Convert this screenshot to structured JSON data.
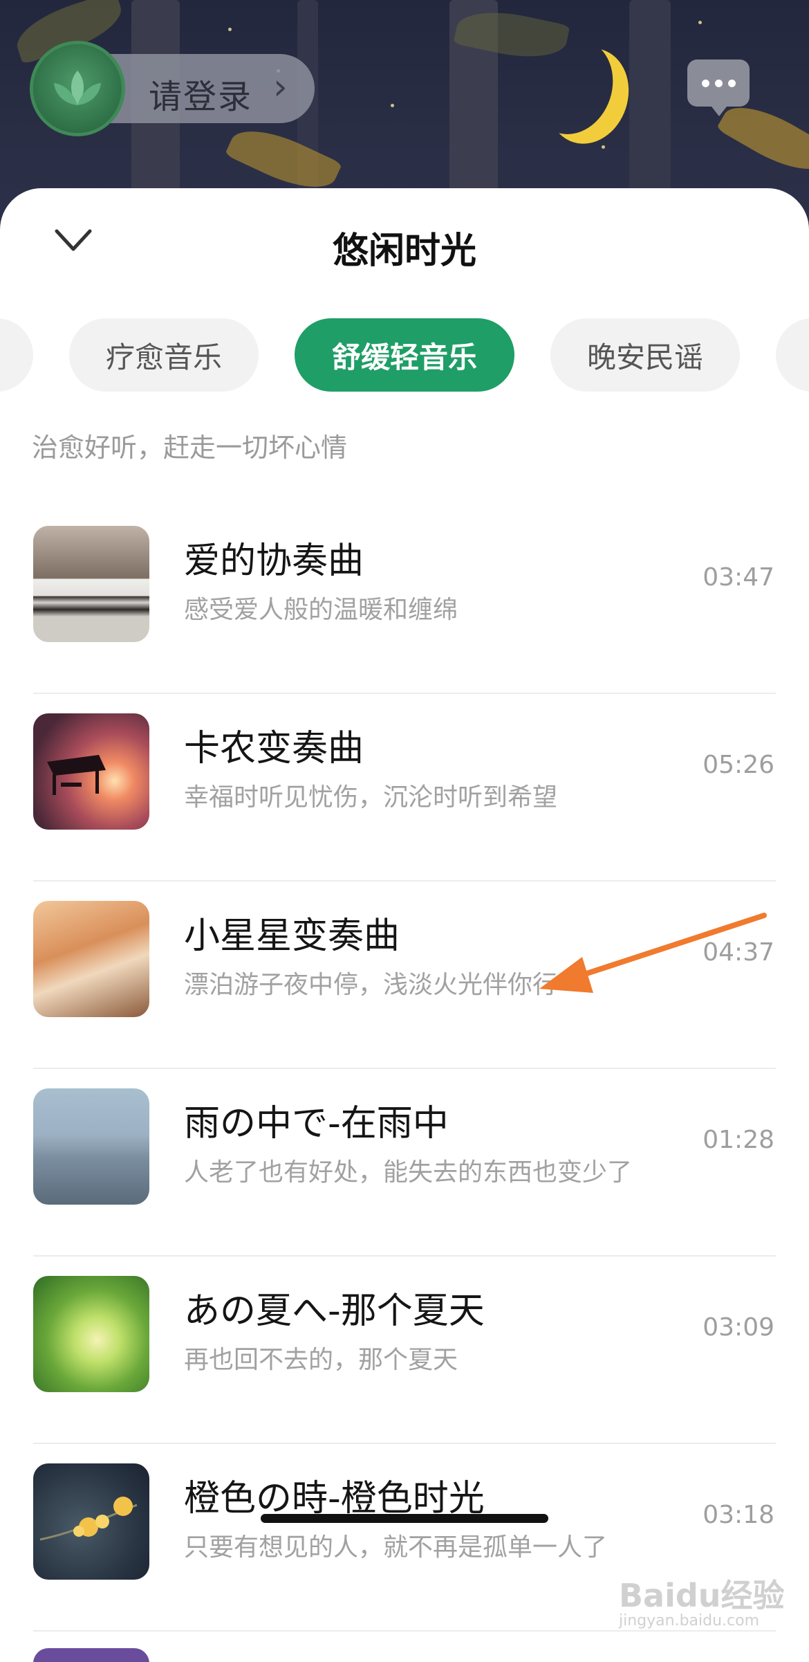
{
  "header": {
    "login_label": "请登录",
    "login_chevron": "›",
    "message_icon": "chat-bubble-icon"
  },
  "sheet": {
    "title": "悠闲时光",
    "collapse_icon": "chevron-down-icon"
  },
  "tabs": [
    {
      "label": ""
    },
    {
      "label": "疗愈音乐"
    },
    {
      "label": "舒缓轻音乐",
      "active": true
    },
    {
      "label": "晚安民谣"
    },
    {
      "label": ""
    }
  ],
  "tagline": "治愈好听，赶走一切坏心情",
  "tracks": [
    {
      "title": "爱的协奏曲",
      "subtitle": "感受爱人般的温暖和缠绵",
      "duration": "03:47"
    },
    {
      "title": "卡农变奏曲",
      "subtitle": "幸福时听见忧伤，沉沦时听到希望",
      "duration": "05:26"
    },
    {
      "title": "小星星变奏曲",
      "subtitle": "漂泊游子夜中停，浅淡火光伴你行",
      "duration": "04:37"
    },
    {
      "title": "雨の中で-在雨中",
      "subtitle": "人老了也有好处，能失去的东西也变少了",
      "duration": "01:28"
    },
    {
      "title": "あの夏へ-那个夏天",
      "subtitle": "再也回不去的，那个夏天",
      "duration": "03:09"
    },
    {
      "title": "橙色の時-橙色时光",
      "subtitle": "只要有想见的人，就不再是孤单一人了",
      "duration": "03:18"
    }
  ],
  "colors": {
    "accent": "#1f9e67",
    "annotation_arrow": "#f07a2e"
  },
  "watermark": {
    "text": "Baidu经验",
    "sub": "jingyan.baidu.com"
  }
}
